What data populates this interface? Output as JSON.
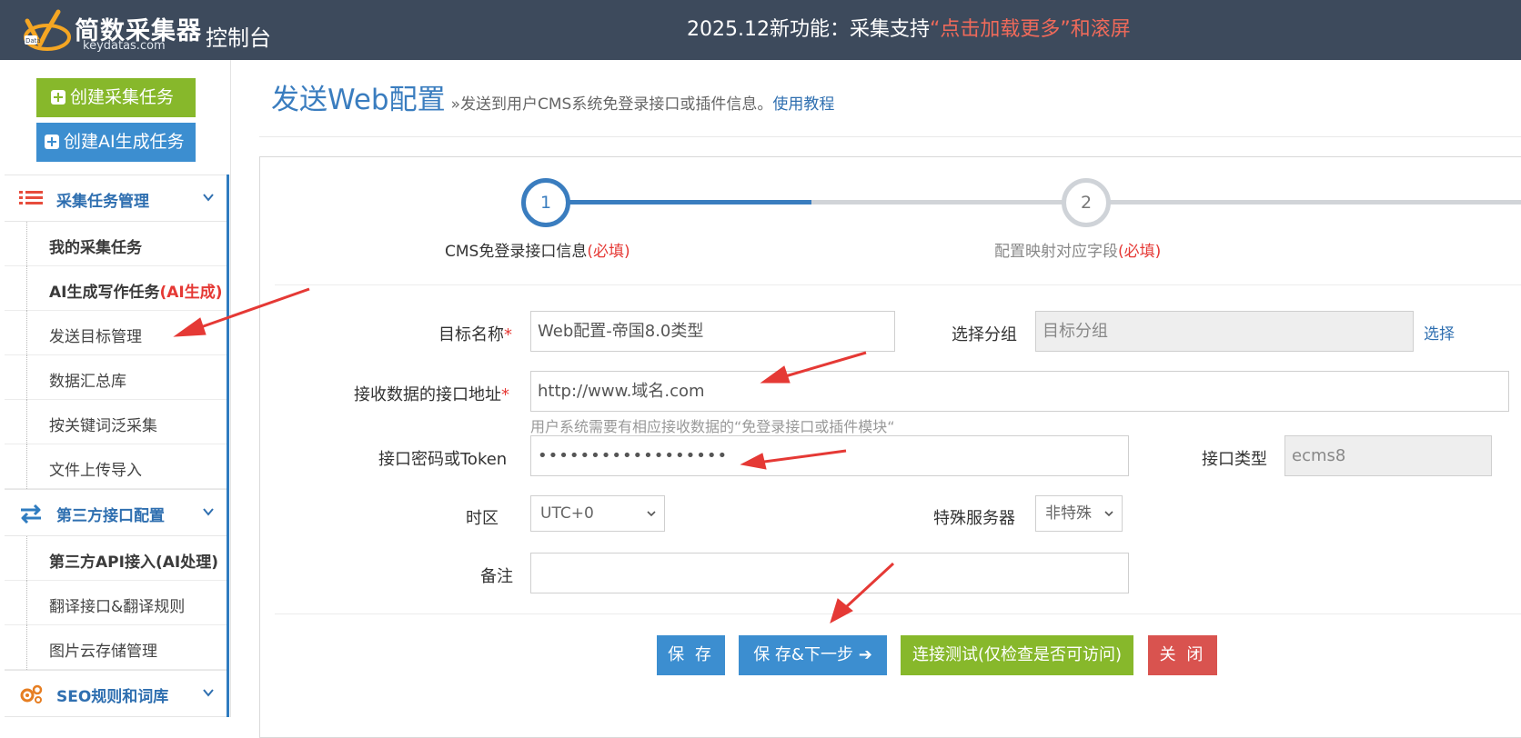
{
  "header": {
    "logo_text": "简数采集器",
    "logo_domain": "keydatas.com",
    "console_title": "控制台",
    "announcement_prefix": "2025.12新功能：采集支持",
    "announcement_highlight": "“点击加载更多”和滚屏"
  },
  "sidebar": {
    "create_collect_label": "创建采集任务",
    "create_ai_label": "创建AI生成任务",
    "sections": [
      {
        "label": "采集任务管理",
        "icon": "list-icon",
        "color": "#e74c3c"
      },
      {
        "label": "第三方接口配置",
        "icon": "exchange-icon",
        "color": "#2f7cc0"
      },
      {
        "label": "SEO规则和词库",
        "icon": "gears-icon",
        "color": "#e67e22"
      }
    ],
    "items": [
      {
        "label": "我的采集任务"
      },
      {
        "label": "AI生成写作任务",
        "tag": "(AI生成)"
      },
      {
        "label": "发送目标管理"
      },
      {
        "label": "数据汇总库"
      },
      {
        "label": "按关键词泛采集"
      },
      {
        "label": "文件上传导入"
      },
      {
        "label": "第三方API接入(AI处理)"
      },
      {
        "label": "翻译接口&翻译规则"
      },
      {
        "label": "图片云存储管理"
      }
    ]
  },
  "page": {
    "title": "发送Web配置",
    "subtitle": "»发送到用户CMS系统免登录接口或插件信息。",
    "tutorial_link": "使用教程"
  },
  "steps": [
    {
      "number": "1",
      "label": "CMS免登录接口信息",
      "required": "(必填)",
      "state": "active"
    },
    {
      "number": "2",
      "label": "配置映射对应字段",
      "required": "(必填)",
      "state": "pending"
    }
  ],
  "form": {
    "target_name_label": "目标名称",
    "target_name_value": "Web配置-帝国8.0类型",
    "group_label": "选择分组",
    "group_placeholder": "目标分组",
    "group_pick_link": "选择",
    "api_url_label": "接收数据的接口地址",
    "api_url_value": "http://www.域名.com",
    "api_url_help": "用户系统需要有相应接收数据的“免登录接口或插件模块“",
    "token_label": "接口密码或Token",
    "token_value": "••••••••••••••••••",
    "api_type_label": "接口类型",
    "api_type_value": "ecms8",
    "timezone_label": "时区",
    "timezone_value": "UTC+0",
    "special_server_label": "特殊服务器",
    "special_server_value": "非特殊",
    "note_label": "备注",
    "note_value": "",
    "required_mark": "*"
  },
  "buttons": {
    "save": "保 存",
    "save_next": "保 存&下一步",
    "test": "连接测试(仅检查是否可访问)",
    "close": "关 闭"
  },
  "colors": {
    "topbar": "#3d4a5c",
    "accent_blue": "#3c8ed0",
    "accent_green": "#87b82b",
    "danger_red": "#d9534f",
    "annotation_arrow": "#e53935"
  }
}
